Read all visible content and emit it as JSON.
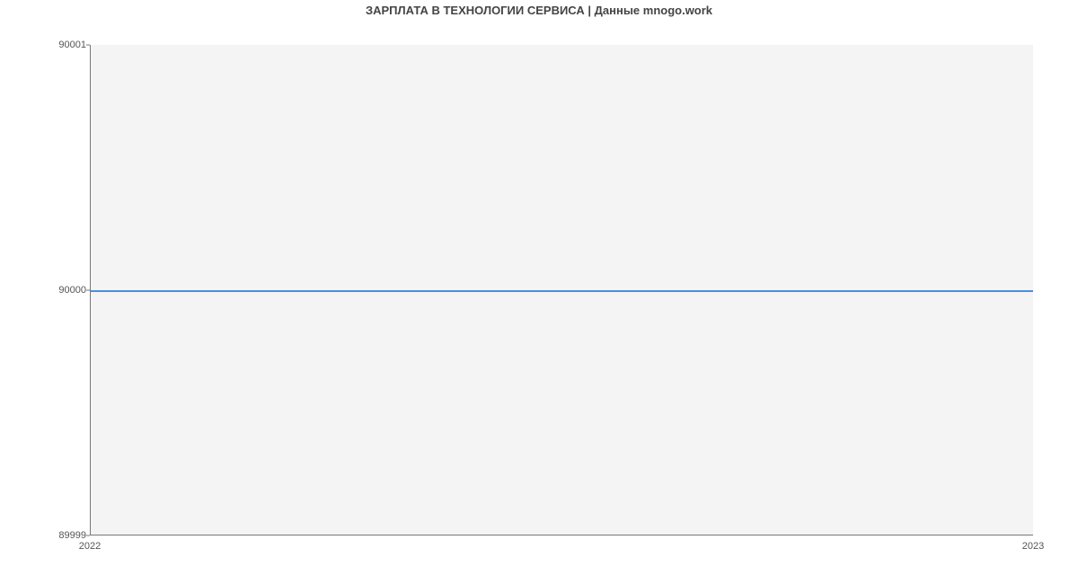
{
  "chart_data": {
    "type": "line",
    "title": "ЗАРПЛАТА В ТЕХНОЛОГИИ СЕРВИСА | Данные mnogo.work",
    "xlabel": "",
    "ylabel": "",
    "x": [
      "2022",
      "2023"
    ],
    "values": [
      90000,
      90000
    ],
    "y_ticks": [
      89999,
      90000,
      90001
    ],
    "x_ticks": [
      "2022",
      "2023"
    ],
    "ylim": [
      89999,
      90001
    ],
    "line_color": "#4e8fd9",
    "plot_bg": "#f4f4f4"
  }
}
